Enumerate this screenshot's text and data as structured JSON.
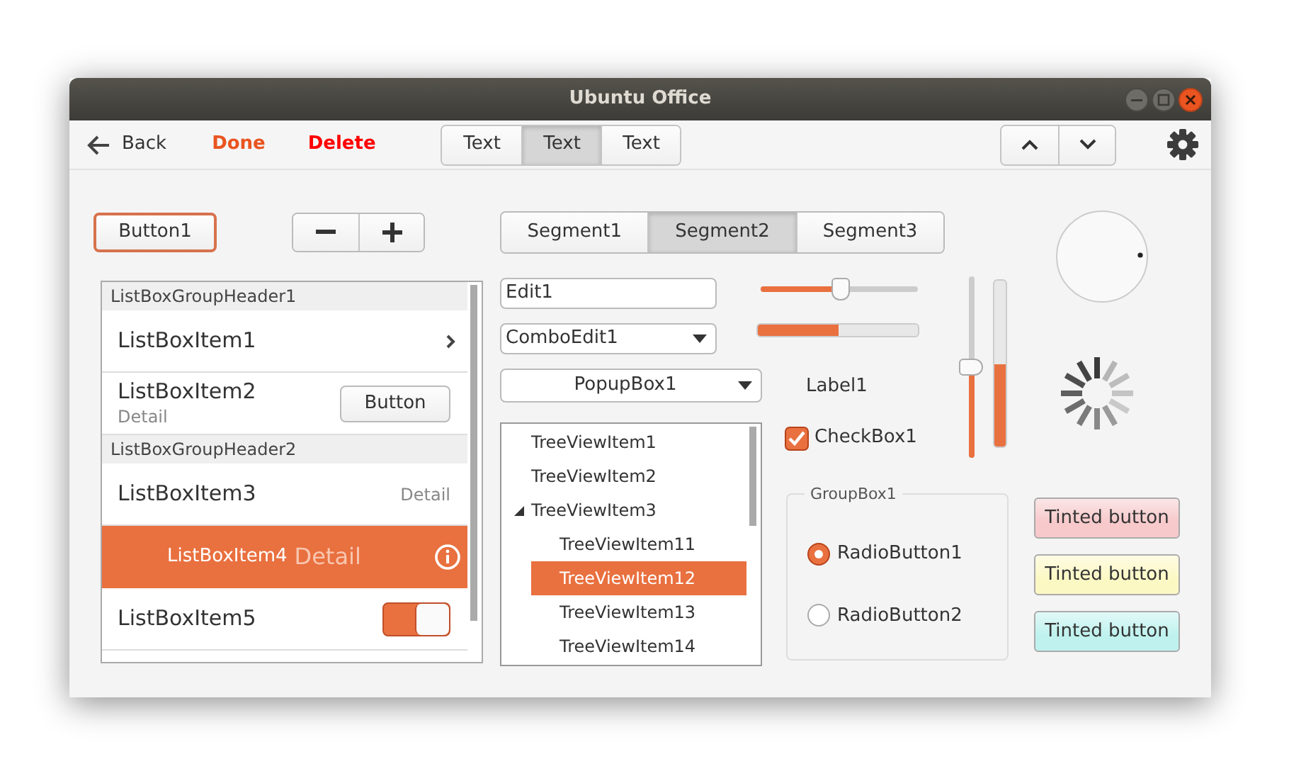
{
  "window": {
    "title": "Ubuntu Office"
  },
  "toolbar": {
    "actions": [
      {
        "kind": "back",
        "label": "Back"
      },
      {
        "kind": "confirm",
        "label": "Done"
      },
      {
        "kind": "destructive",
        "label": "Delete"
      }
    ],
    "segments": [
      {
        "label": "Text",
        "selected": false
      },
      {
        "label": "Text",
        "selected": true
      },
      {
        "label": "Text",
        "selected": false
      }
    ]
  },
  "button1": {
    "label": "Button1",
    "default": true
  },
  "segments": [
    {
      "label": "Segment1",
      "selected": false
    },
    {
      "label": "Segment2",
      "selected": true
    },
    {
      "label": "Segment3",
      "selected": false
    }
  ],
  "listbox": {
    "rows": [
      {
        "kind": "header",
        "label": "ListBoxGroupHeader1"
      },
      {
        "kind": "chevron",
        "label": "ListBoxItem1",
        "selected": false
      },
      {
        "kind": "button",
        "label": "ListBoxItem2",
        "detail": "Detail",
        "button": "Button",
        "selected": false
      },
      {
        "kind": "header",
        "label": "ListBoxGroupHeader2"
      },
      {
        "kind": "detail",
        "label": "ListBoxItem3",
        "detail": "Detail",
        "selected": false
      },
      {
        "kind": "info",
        "label": "ListBoxItem4",
        "detail": "Detail",
        "selected": true
      },
      {
        "kind": "switch",
        "label": "ListBoxItem5",
        "on": true,
        "selected": false
      }
    ]
  },
  "edit": {
    "value": "Edit1"
  },
  "combo_edit": {
    "value": "ComboEdit1"
  },
  "popup_box": {
    "value": "PopupBox1"
  },
  "tree": {
    "items": [
      {
        "label": "TreeViewItem1",
        "selected": false
      },
      {
        "label": "TreeViewItem2",
        "selected": false
      },
      {
        "label": "TreeViewItem3",
        "selected": false,
        "expanded": true,
        "children": [
          {
            "label": "TreeViewItem11",
            "selected": false
          },
          {
            "label": "TreeViewItem12",
            "selected": true
          },
          {
            "label": "TreeViewItem13",
            "selected": false
          },
          {
            "label": "TreeViewItem14",
            "selected": false
          }
        ]
      }
    ]
  },
  "slider": {
    "level": 0.5
  },
  "progress": {
    "level": 0.5
  },
  "label": "Label1",
  "checkbox": {
    "label": "CheckBox1",
    "checked": true
  },
  "vertical_slider": {
    "level": 0.5
  },
  "vertical_progress": {
    "level": 0.5
  },
  "group_box": {
    "title": "GroupBox1",
    "radios": [
      {
        "label": "RadioButton1",
        "selected": true
      },
      {
        "label": "RadioButton2",
        "selected": false
      }
    ]
  },
  "tinted_buttons": [
    {
      "label": "Tinted button",
      "color": "#f7c9cb"
    },
    {
      "label": "Tinted button",
      "color": "#fcf8c4"
    },
    {
      "label": "Tinted button",
      "color": "#bff2ee"
    }
  ]
}
